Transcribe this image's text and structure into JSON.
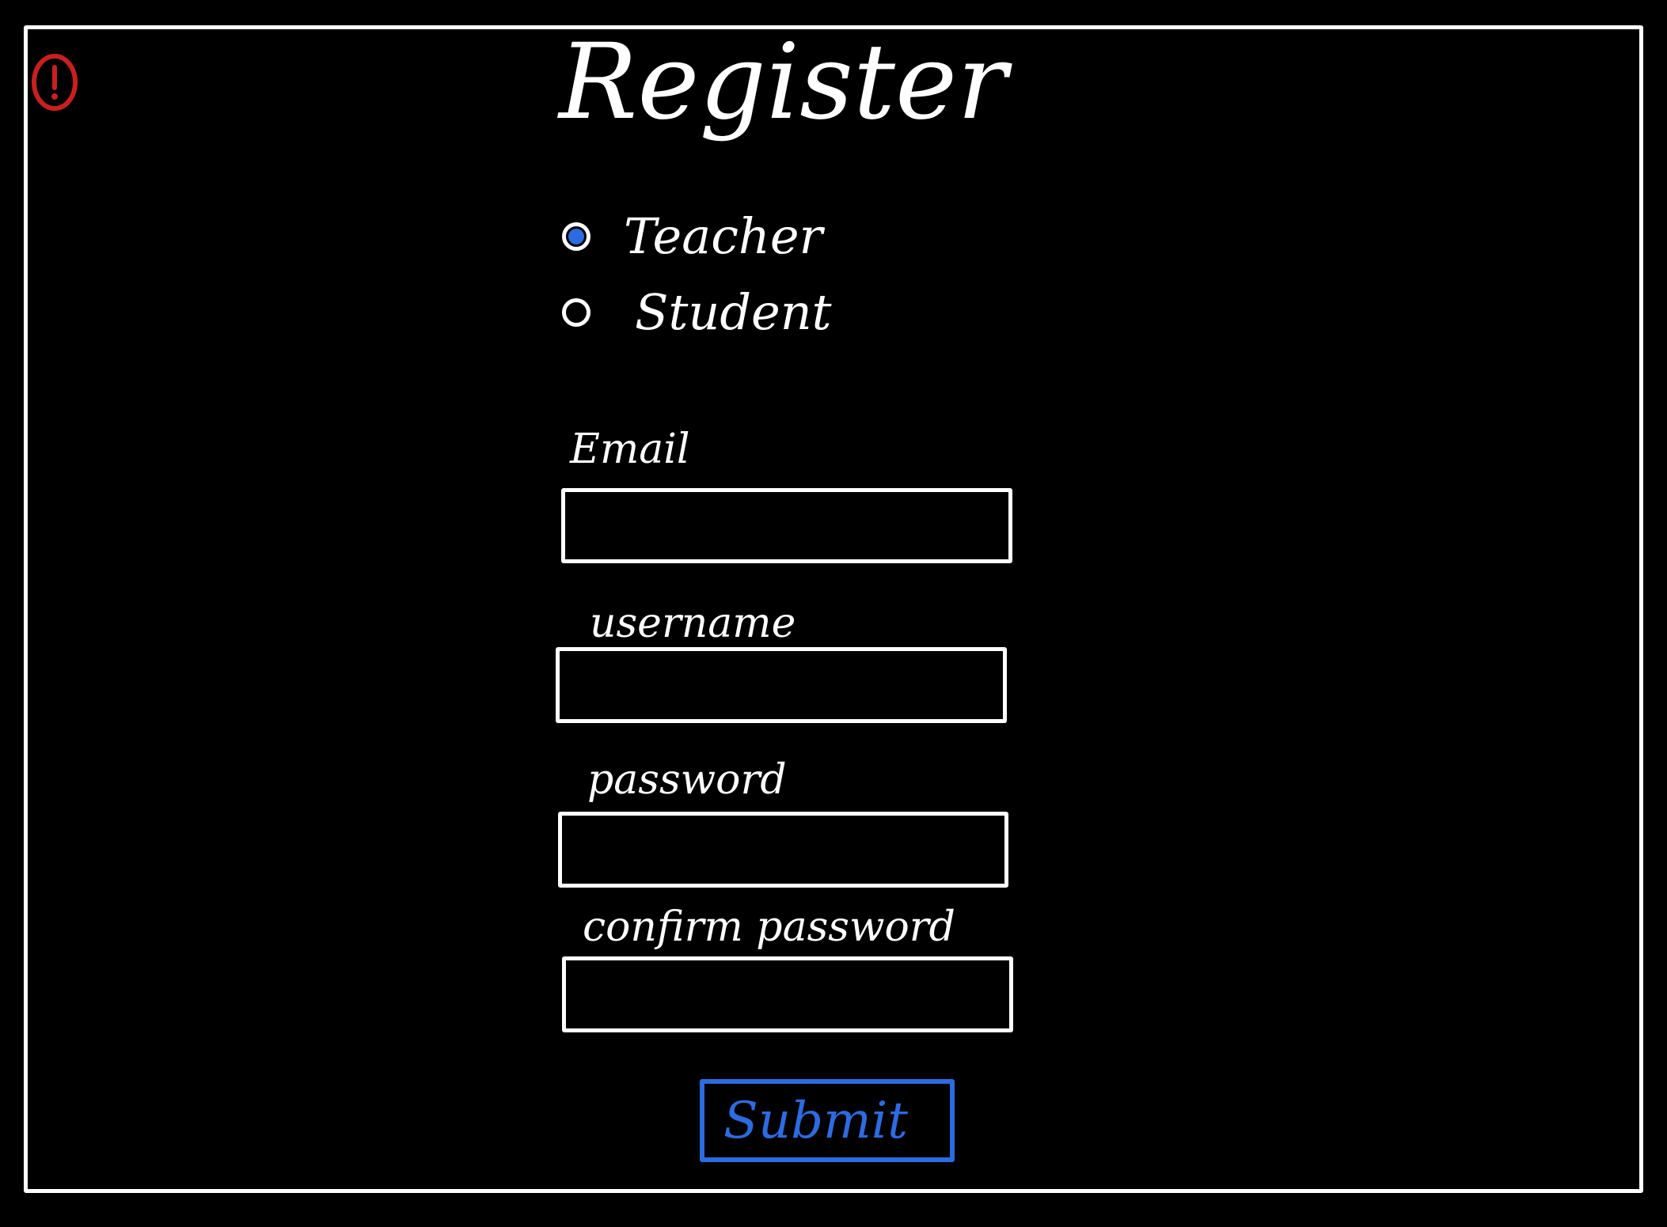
{
  "page": {
    "title": "Register"
  },
  "alert": {
    "icon": "alert-circle-icon",
    "color": "#c82020"
  },
  "role": {
    "options": [
      {
        "label": "Teacher",
        "selected": true
      },
      {
        "label": "Student",
        "selected": false
      }
    ]
  },
  "form": {
    "email": {
      "label": "Email",
      "value": ""
    },
    "username": {
      "label": "username",
      "value": ""
    },
    "password": {
      "label": "password",
      "value": ""
    },
    "confirm_password": {
      "label": "confirm password",
      "value": ""
    },
    "submit_label": "Submit"
  },
  "colors": {
    "background": "#000000",
    "foreground": "#ffffff",
    "accent": "#2d6be0",
    "alert": "#c82020"
  }
}
